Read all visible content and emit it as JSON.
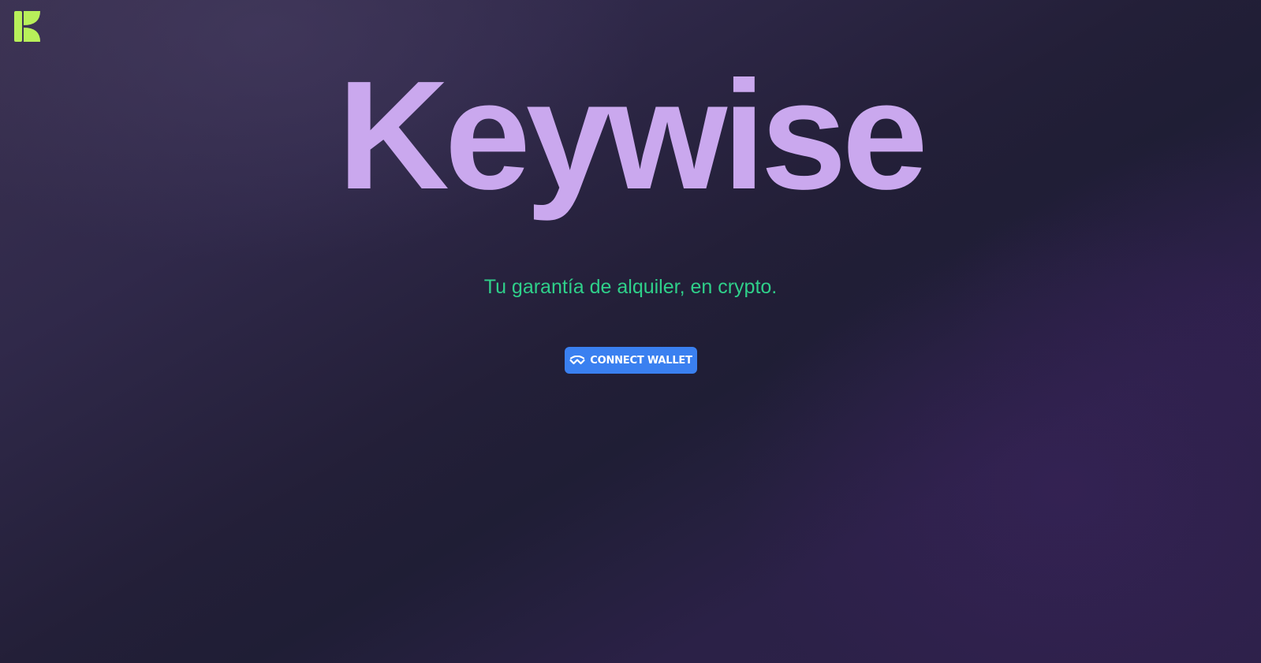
{
  "brand": {
    "logo_icon": "keywise-k-logo-icon",
    "logo_color": "#b8f05a",
    "title": "Keywise",
    "title_color": "#caa8ee"
  },
  "hero": {
    "tagline": "Tu garantía de alquiler, en crypto.",
    "tagline_color": "#2fd08a"
  },
  "actions": {
    "connect_wallet_label": "CONNECT WALLET",
    "connect_wallet_icon": "walletconnect-icon",
    "button_color": "#3a80f0"
  }
}
